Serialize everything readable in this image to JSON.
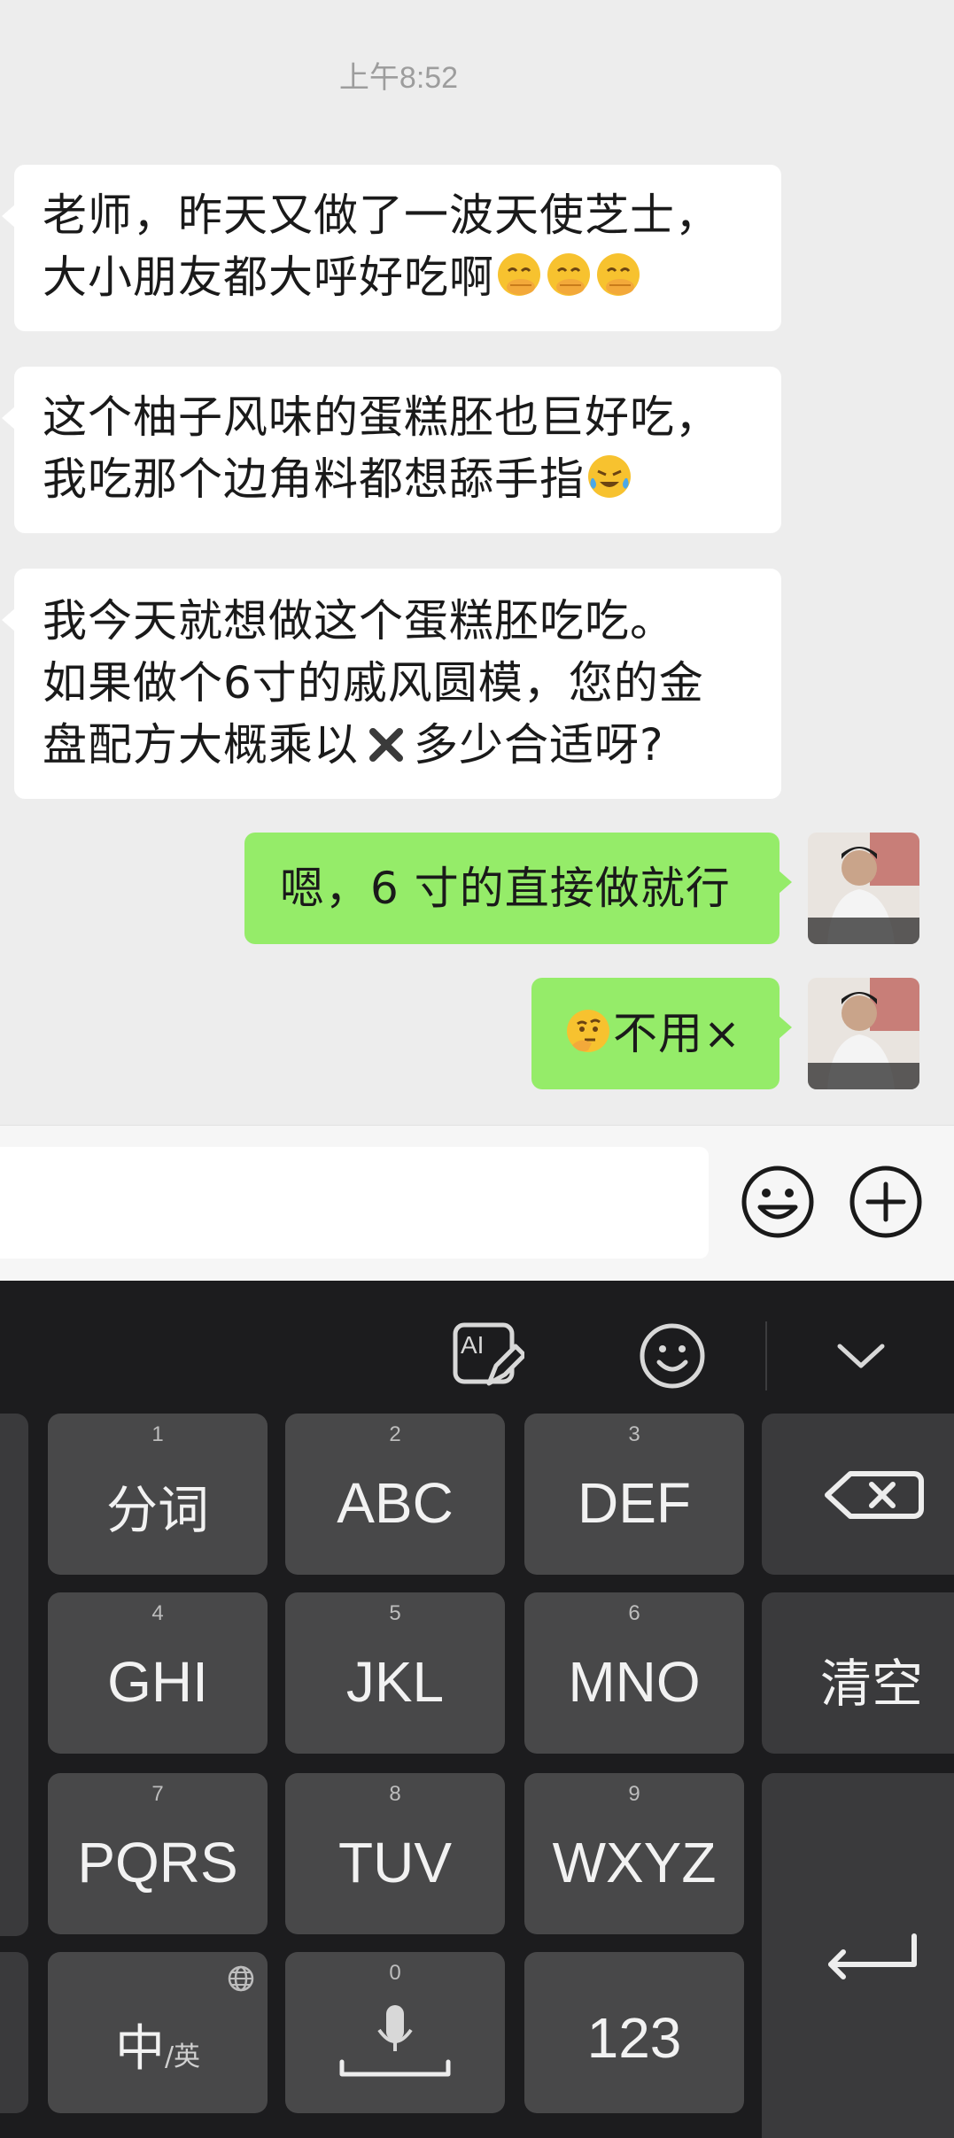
{
  "chat": {
    "timestamp": "上午8:52",
    "messages": [
      {
        "side": "in",
        "lines": [
          "老师，昨天又做了一波天使芝士，",
          "大小朋友都大呼好吃啊"
        ],
        "emoji": "laughing-hand-over-mouth-emoji x3"
      },
      {
        "side": "in",
        "lines": [
          "这个柚子风味的蛋糕胚也巨好吃，",
          "我吃那个边角料都想舔手指"
        ],
        "emoji": "crying-laughing-emoji"
      },
      {
        "side": "in",
        "lines": [
          "我今天就想做这个蛋糕胚吃吃。",
          "如果做个6寸的戚风圆模，您的金",
          "盘配方大概乘以",
          "多少合适呀?"
        ],
        "emoji": "multiply-sign"
      },
      {
        "side": "out",
        "text": "嗯，6 寸的直接做就行"
      },
      {
        "side": "out",
        "text": "不用×",
        "emoji": "thinking-emoji"
      }
    ]
  },
  "keyboard": {
    "keys": [
      {
        "num": "1",
        "label": "分词"
      },
      {
        "num": "2",
        "label": "ABC"
      },
      {
        "num": "3",
        "label": "DEF"
      },
      {
        "num": "4",
        "label": "GHI"
      },
      {
        "num": "5",
        "label": "JKL"
      },
      {
        "num": "6",
        "label": "MNO"
      },
      {
        "num": "7",
        "label": "PQRS"
      },
      {
        "num": "8",
        "label": "TUV"
      },
      {
        "num": "9",
        "label": "WXYZ"
      },
      {
        "num": "0",
        "label": ""
      }
    ],
    "clear_label": "清空",
    "lang_main": "中",
    "lang_sub": "/英",
    "num_label": "123",
    "colors": {
      "bg": "#1c1c1e",
      "key": "#484849",
      "bubble_out": "#95ec69",
      "bubble_in": "#ffffff"
    }
  }
}
